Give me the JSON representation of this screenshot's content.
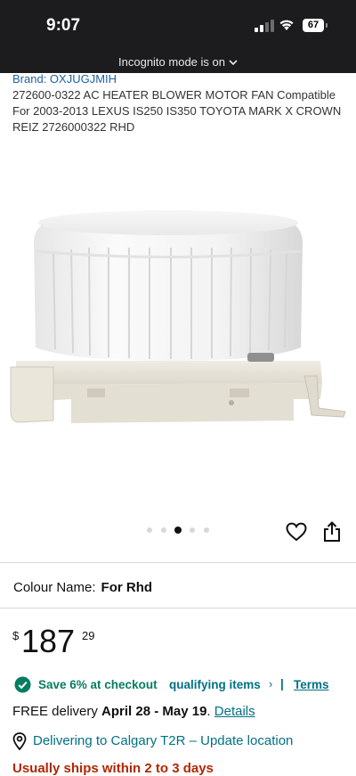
{
  "status_bar": {
    "time": "9:07",
    "battery": "67",
    "incognito_text": "Incognito mode is on"
  },
  "product": {
    "brand": "Brand: OXJUGJMIH",
    "title": "272600-0322 AC HEATER BLOWER MOTOR FAN Compatible For 2003-2013 LEXUS IS250 IS350 TOYOTA MARK X CROWN REIZ 2726000322 RHD",
    "image_icon": "blower-motor-image",
    "carousel": {
      "count": 5,
      "active_index": 2
    }
  },
  "actions": {
    "wishlist_icon": "heart-icon",
    "share_icon": "share-icon"
  },
  "colour": {
    "label": "Colour Name:",
    "value": "For Rhd"
  },
  "price": {
    "symbol": "$",
    "whole": "187",
    "fraction": "29"
  },
  "coupon": {
    "save_text": "Save 6% at checkout",
    "qualifying_link": "qualifying items",
    "chevron": "›",
    "separator": "|",
    "terms_link": "Terms"
  },
  "delivery": {
    "prefix": "FREE delivery",
    "dates": "April 28 - May 19",
    "suffix": ".",
    "details_link": "Details"
  },
  "location": {
    "text": "Delivering to Calgary T2R – Update location"
  },
  "shipping": {
    "text": "Usually ships within 2 to 3 days"
  },
  "colors": {
    "link": "#007185",
    "success": "#067d62",
    "brand_link": "#2162a1",
    "alert": "#b12704"
  }
}
